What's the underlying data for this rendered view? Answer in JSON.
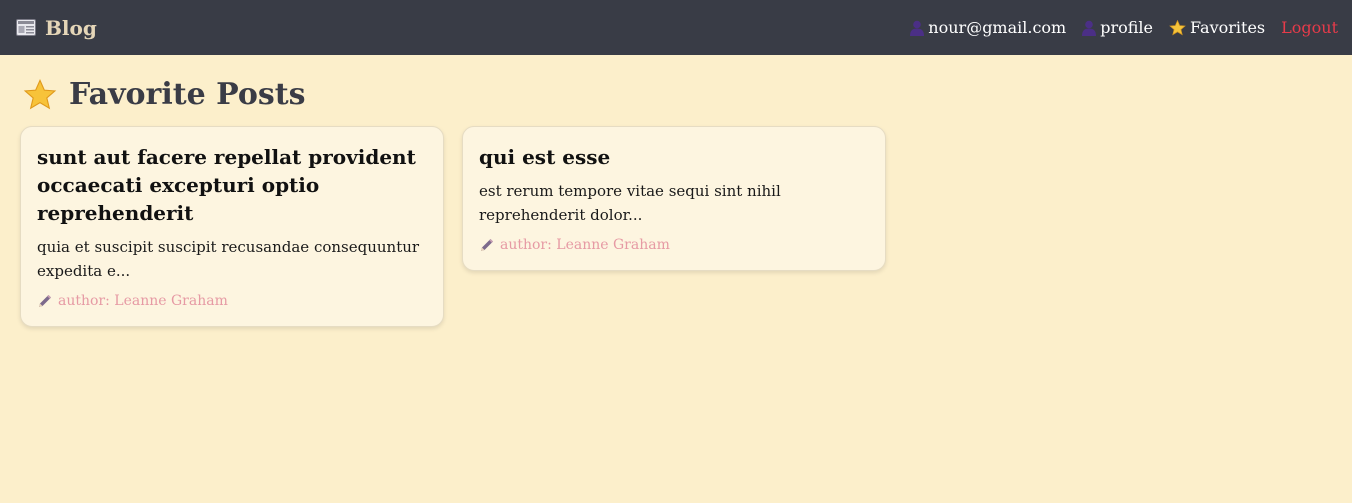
{
  "nav": {
    "brand": "Blog",
    "email": "nour@gmail.com",
    "profile": "profile",
    "favorites": "Favorites",
    "logout": "Logout"
  },
  "page": {
    "title": "Favorite Posts"
  },
  "posts": [
    {
      "title": "sunt aut facere repellat provident occaecati excepturi optio reprehenderit",
      "excerpt": "quia et suscipit suscipit recusandae consequuntur expedita e...",
      "author": "author: Leanne Graham"
    },
    {
      "title": "qui est esse",
      "excerpt": "est rerum tempore vitae sequi sint nihil reprehenderit dolor...",
      "author": "author: Leanne Graham"
    }
  ],
  "icons": {
    "brand": "newspaper-icon",
    "email": "user-icon",
    "profile": "user-icon",
    "favorites": "star-icon",
    "title": "star-icon",
    "author": "pencil-icon"
  },
  "colors": {
    "navbar": "#393c46",
    "background": "#fcefcb",
    "card": "#fdf5e0",
    "logout": "#e63b4a",
    "author": "#e69aa4",
    "brand": "#e5d6b8"
  }
}
